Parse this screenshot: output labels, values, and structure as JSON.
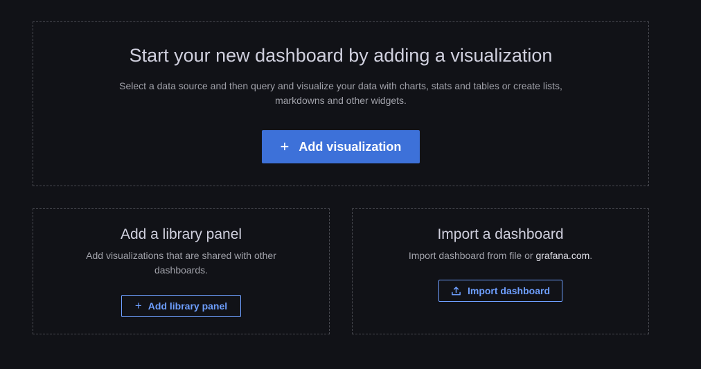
{
  "hero": {
    "title": "Start your new dashboard by adding a visualization",
    "description_line1": "Select a data source and then query and visualize your data with charts, stats and tables or create lists,",
    "description_line2": "markdowns and other widgets.",
    "button_icon": "+",
    "button_label": "Add visualization"
  },
  "library": {
    "title": "Add a library panel",
    "description_line1": "Add visualizations that are shared with other",
    "description_line2": "dashboards.",
    "button_icon": "+",
    "button_label": "Add library panel"
  },
  "import": {
    "title": "Import a dashboard",
    "description": "Import dashboard from file or ",
    "description_link": "grafana.com",
    "description_end": ".",
    "button_label": "Import dashboard"
  },
  "colors": {
    "background": "#111217",
    "primary": "#3d71d9",
    "link": "#6e9fff"
  }
}
